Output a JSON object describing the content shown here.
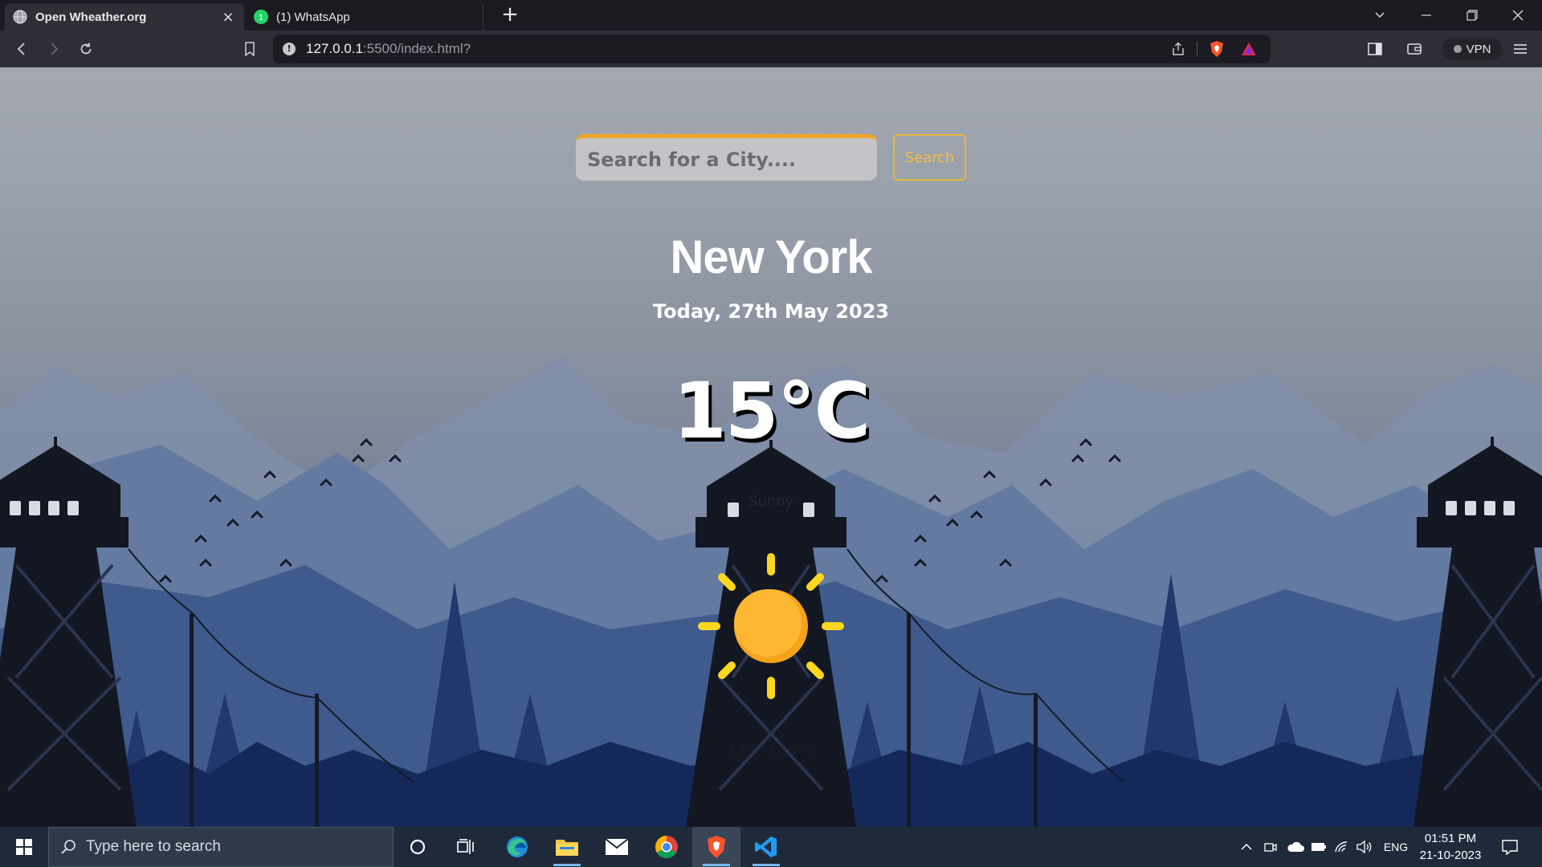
{
  "browser": {
    "tabs": [
      {
        "title": "Open Wheather.org",
        "icon": "globe-icon",
        "active": true
      },
      {
        "title": "(1) WhatsApp",
        "icon": "whatsapp-icon",
        "active": false
      }
    ],
    "url": {
      "host": "127.0.0.1",
      "rest": ":5500/index.html?"
    },
    "vpn_label": "VPN",
    "icons": {
      "back": "back-arrow-icon",
      "forward": "forward-arrow-icon",
      "reload": "reload-icon",
      "bookmark": "bookmark-icon",
      "share": "share-icon",
      "brave": "brave-shields-icon",
      "rewards": "brave-rewards-icon",
      "sidebar": "sidebar-icon",
      "wallet": "wallet-icon",
      "menu": "menu-icon"
    }
  },
  "weather": {
    "search_placeholder": "Search for a City....",
    "search_button": "Search",
    "city": "New York",
    "date": "Today, 27th May 2023",
    "temperature": "15°C",
    "condition": "Sunny",
    "range": "13°C / 16°C",
    "icon": "sun-icon"
  },
  "taskbar": {
    "search_placeholder": "Type here to search",
    "apps": [
      "cortana-icon",
      "task-view-icon",
      "edge-icon",
      "file-explorer-icon",
      "mail-icon",
      "chrome-icon",
      "brave-icon",
      "vscode-icon"
    ],
    "language": "ENG",
    "time": "01:51 PM",
    "date": "21-10-2023"
  },
  "colors": {
    "accent": "#f0a528",
    "search_button": "#f5be3e",
    "taskbar": "#1e2a3a",
    "browser_chrome": "#2f2e36"
  }
}
